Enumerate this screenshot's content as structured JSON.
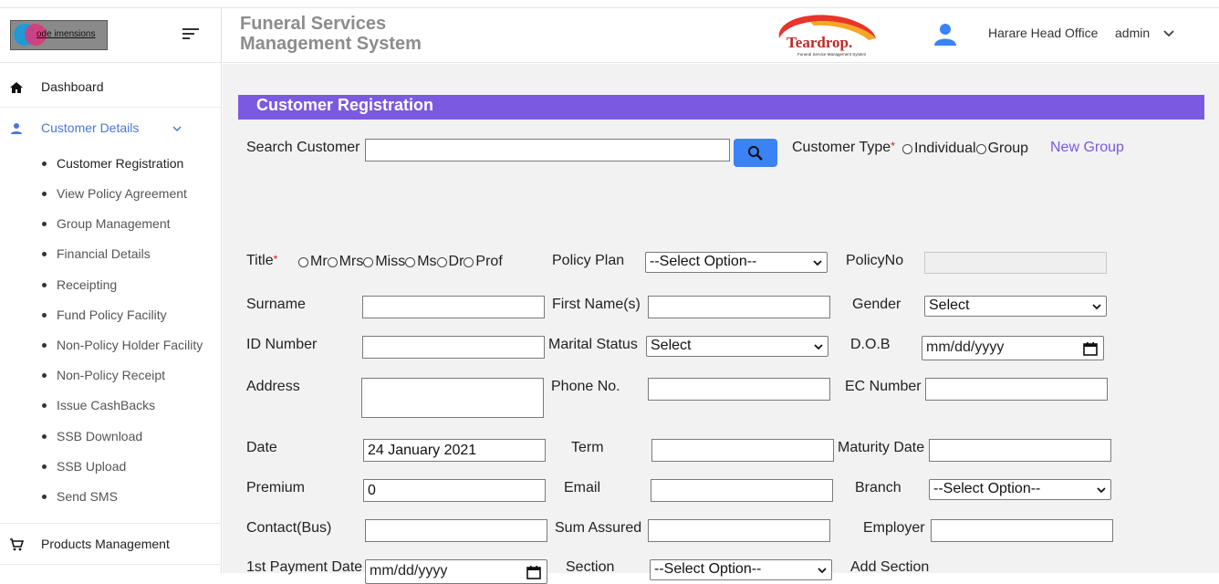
{
  "brand": {
    "logo_text": "ode   imensions",
    "app_logo_text": "Teardrop.",
    "app_logo_sub": "Funeral Service Management System"
  },
  "header": {
    "title_line1": "Funeral Services",
    "title_line2": "Management System",
    "office": "Harare Head Office",
    "user": "admin"
  },
  "sidebar": {
    "dashboard": "Dashboard",
    "customer_details": "Customer Details",
    "sub_items": [
      "Customer Registration",
      "View Policy Agreement",
      "Group Management",
      "Financial Details",
      "Receipting",
      "Fund Policy Facility",
      "Non-Policy Holder Facility",
      "Non-Policy Receipt",
      "Issue CashBacks",
      "SSB Download",
      "SSB Upload",
      "Send SMS"
    ],
    "products_management": "Products Management"
  },
  "colors": {
    "accent": "#7b59e0",
    "link": "#4a76d8",
    "button": "#3b82f6"
  },
  "form": {
    "banner_title": "Customer Registration",
    "search_label": "Search Customer",
    "customer_type_label": "Customer Type",
    "required_mark": "*",
    "customer_type_options": [
      "Individual",
      "Group"
    ],
    "new_group": "New Group",
    "title_label": "Title",
    "title_options": [
      "Mr",
      "Mrs",
      "Miss",
      "Ms",
      "Dr",
      "Prof"
    ],
    "policy_plan_label": "Policy Plan",
    "policy_plan_value": "--Select Option--",
    "policy_no_label": "PolicyNo",
    "surname_label": "Surname",
    "first_name_label": "First Name(s)",
    "gender_label": "Gender",
    "gender_value": "Select",
    "id_number_label": "ID Number",
    "marital_status_label": "Marital Status",
    "marital_status_value": "Select",
    "dob_label": "D.O.B",
    "dob_placeholder": "mm/dd/yyyy",
    "address_label": "Address",
    "phone_label": "Phone No.",
    "ec_number_label": "EC Number",
    "date_label": "Date",
    "date_value": "24 January 2021",
    "term_label": "Term",
    "maturity_label": "Maturity Date",
    "premium_label": "Premium",
    "premium_value": "0",
    "email_label": "Email",
    "branch_label": "Branch",
    "branch_value": "--Select Option--",
    "contact_label": "Contact(Bus)",
    "sum_assured_label": "Sum Assured",
    "employer_label": "Employer",
    "first_payment_label": "1st Payment Date",
    "first_payment_placeholder": "mm/dd/yyyy",
    "section_label": "Section",
    "section_value": "--Select Option--",
    "add_section": "Add Section"
  }
}
